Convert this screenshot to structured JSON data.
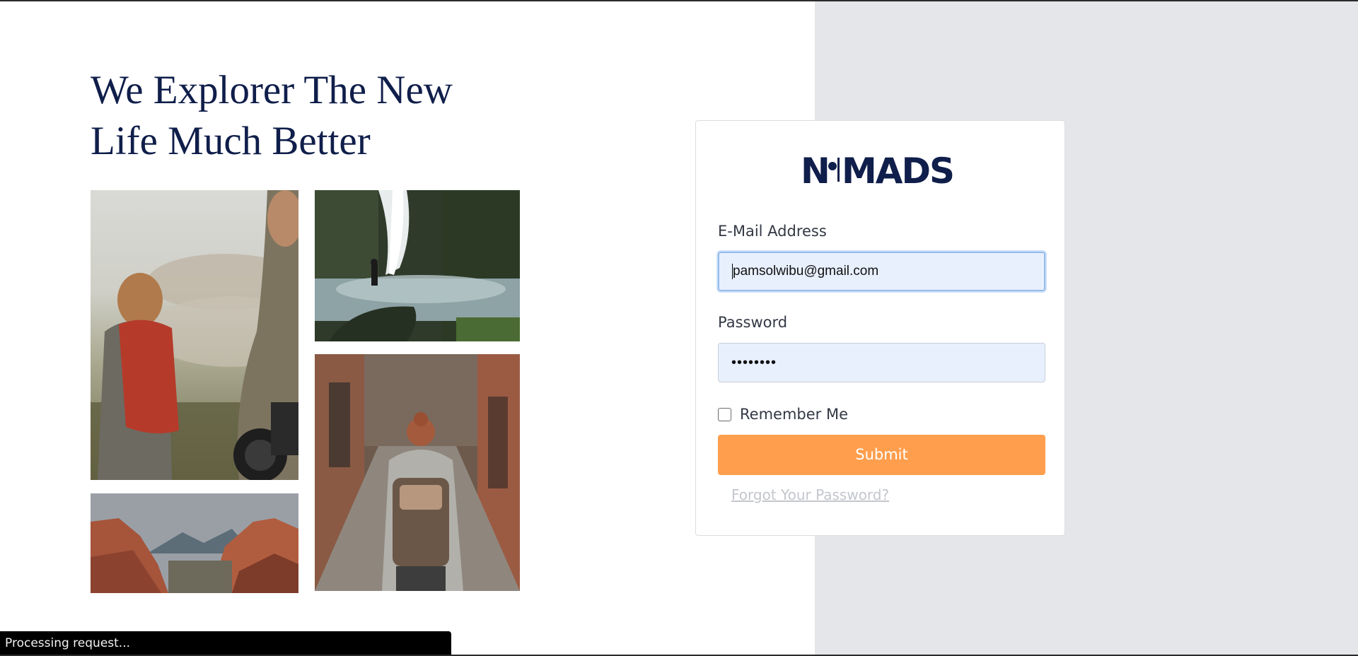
{
  "headline": {
    "line1": "We Explorer The New",
    "line2": "Life Much Better"
  },
  "photos": [
    {
      "name": "hikers-with-camera",
      "alt": "Hikers with camera"
    },
    {
      "name": "waterfall-hiker",
      "alt": "Hiker at waterfall"
    },
    {
      "name": "alley-backpacker",
      "alt": "Backpacker in alley"
    },
    {
      "name": "red-rock-mountains",
      "alt": "Red rock mountains"
    }
  ],
  "login": {
    "logo_text": "NOMADS",
    "email_label": "E-Mail Address",
    "email_value": "pamsolwibu@gmail.com",
    "password_label": "Password",
    "password_value": "••••••••",
    "remember_label": "Remember Me",
    "submit_label": "Submit",
    "forgot_label": "Forgot Your Password?"
  },
  "status_bar": {
    "text": "Processing request..."
  },
  "colors": {
    "navy": "#0f1e4a",
    "accent": "#ff9e4d",
    "panel_bg": "#e5e6ea",
    "input_bg": "#e8f0fe"
  }
}
